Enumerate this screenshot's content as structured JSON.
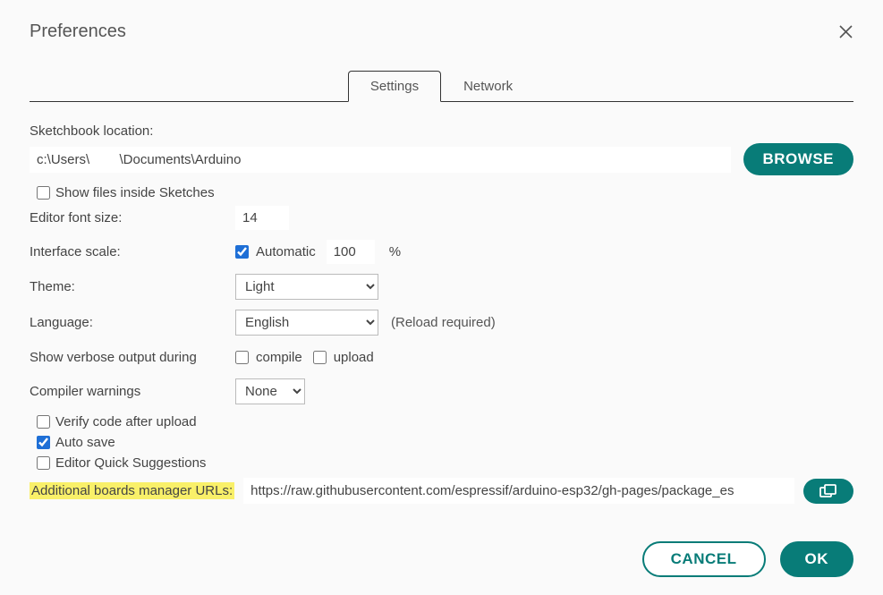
{
  "dialog": {
    "title": "Preferences",
    "tabs": {
      "settings": "Settings",
      "network": "Network"
    }
  },
  "settings": {
    "sketchbook_label": "Sketchbook location:",
    "sketchbook_path": "c:\\Users\\        \\Documents\\Arduino",
    "browse": "BROWSE",
    "show_files_label": "Show files inside Sketches",
    "show_files_checked": false,
    "font_size_label": "Editor font size:",
    "font_size_value": "14",
    "scale_label": "Interface scale:",
    "scale_auto_label": "Automatic",
    "scale_auto_checked": true,
    "scale_value": "100",
    "scale_unit": "%",
    "theme_label": "Theme:",
    "theme_value": "Light",
    "language_label": "Language:",
    "language_value": "English",
    "language_hint": "(Reload required)",
    "verbose_label": "Show verbose output during",
    "verbose_compile_label": "compile",
    "verbose_compile_checked": false,
    "verbose_upload_label": "upload",
    "verbose_upload_checked": false,
    "warnings_label": "Compiler warnings",
    "warnings_value": "None",
    "verify_label": "Verify code after upload",
    "verify_checked": false,
    "autosave_label": "Auto save",
    "autosave_checked": true,
    "quick_label": "Editor Quick Suggestions",
    "quick_checked": false,
    "urls_label": "Additional boards manager URLs:",
    "urls_value": "https://raw.githubusercontent.com/espressif/arduino-esp32/gh-pages/package_es"
  },
  "footer": {
    "cancel": "CANCEL",
    "ok": "OK"
  }
}
